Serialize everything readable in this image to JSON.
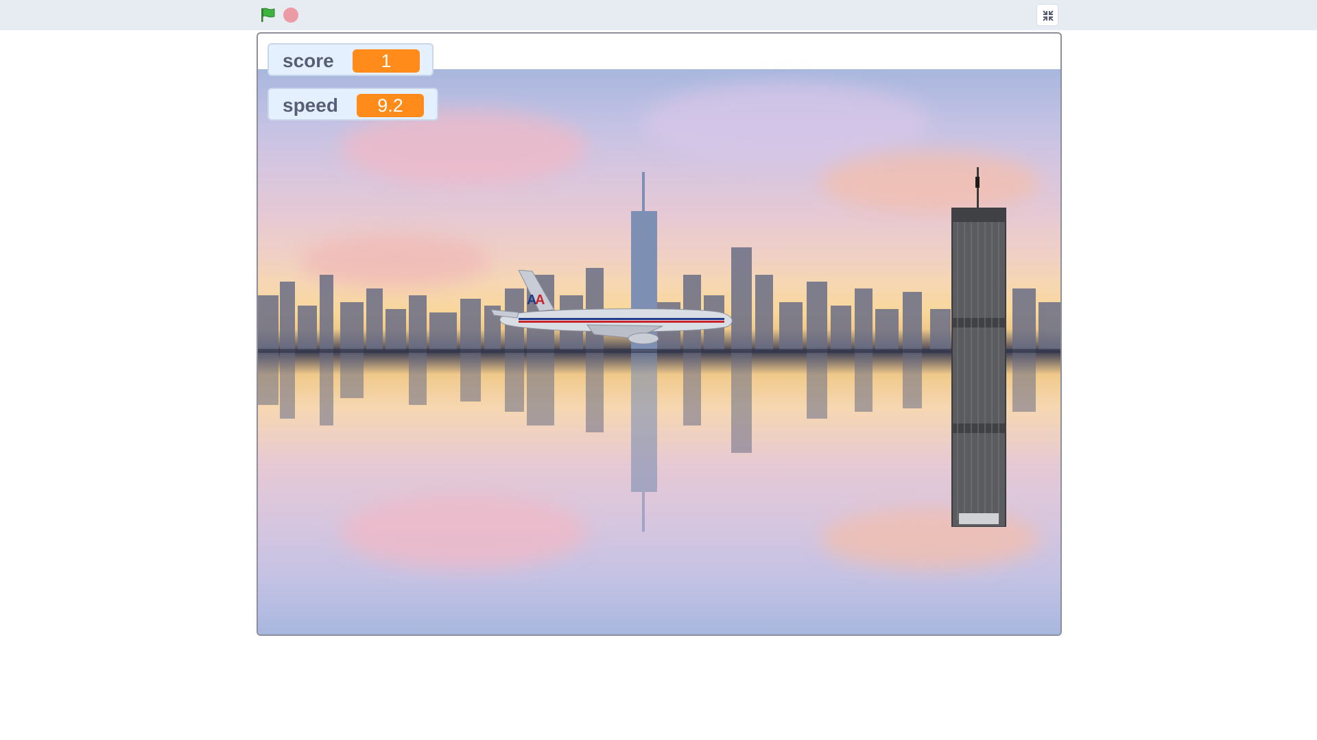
{
  "toolbar": {
    "green_flag_icon": "green-flag-icon",
    "stop_icon": "stop-icon",
    "fullscreen_icon": "exit-fullscreen-icon",
    "flag_color": "#3cb33c",
    "stop_color": "#ec9aa4"
  },
  "monitors": {
    "score": {
      "label": "score",
      "value": "1"
    },
    "speed": {
      "label": "speed",
      "value": "9.2"
    }
  },
  "stage": {
    "backdrop": "city skyline reflected on water at sunset",
    "sprites": [
      "airplane",
      "tower"
    ]
  },
  "colors": {
    "monitor_value_bg": "#ff8c1a",
    "monitor_bg": "#e5f0ff",
    "monitor_text": "#575e75"
  }
}
